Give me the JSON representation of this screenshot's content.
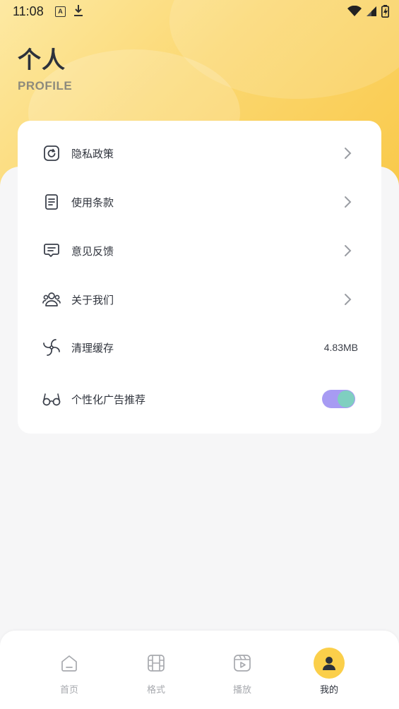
{
  "status_bar": {
    "time": "11:08",
    "a_badge": "A",
    "icons": [
      "font-notification-icon",
      "download-icon",
      "wifi-icon",
      "signal-icon",
      "battery-icon"
    ]
  },
  "header": {
    "title": "个人",
    "subtitle": "PROFILE",
    "colors": {
      "gradient_start": "#fde9a3",
      "gradient_end": "#f9c94a"
    }
  },
  "menu": {
    "items": [
      {
        "label": "隐私政策",
        "icon": "privacy-icon",
        "trailing": "chevron"
      },
      {
        "label": "使用条款",
        "icon": "document-icon",
        "trailing": "chevron"
      },
      {
        "label": "意见反馈",
        "icon": "feedback-icon",
        "trailing": "chevron"
      },
      {
        "label": "关于我们",
        "icon": "team-icon",
        "trailing": "chevron"
      },
      {
        "label": "清理缓存",
        "icon": "fan-icon",
        "trailing": "value",
        "value": "4.83MB"
      },
      {
        "label": "个性化广告推荐",
        "icon": "glasses-icon",
        "trailing": "toggle",
        "enabled": true
      }
    ]
  },
  "tab_bar": {
    "items": [
      {
        "label": "首页",
        "icon": "home-icon",
        "active": false
      },
      {
        "label": "格式",
        "icon": "film-icon",
        "active": false
      },
      {
        "label": "播放",
        "icon": "play-icon",
        "active": false
      },
      {
        "label": "我的",
        "icon": "user-icon",
        "active": true
      }
    ],
    "colors": {
      "active_bg": "#fbcf4a",
      "inactive_text": "#a7a9ae"
    }
  }
}
